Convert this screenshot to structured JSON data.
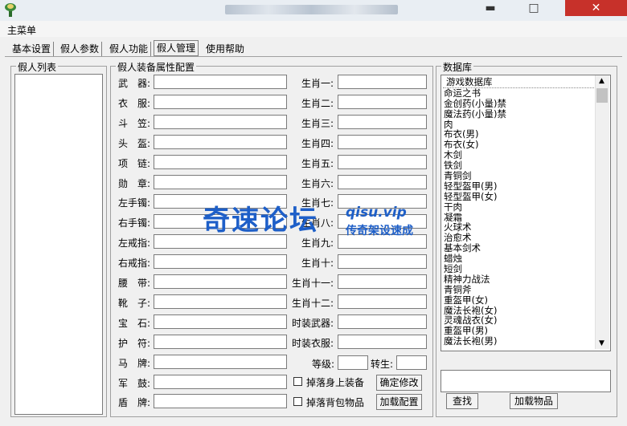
{
  "window": {
    "title": "",
    "controls": {
      "minimize": "▬",
      "maximize": "□",
      "close": "✕"
    }
  },
  "menu": {
    "main": "主菜单"
  },
  "tabs": [
    "基本设置",
    "假人参数",
    "假人功能",
    "假人管理",
    "使用帮助"
  ],
  "active_tab": "假人管理",
  "left_panel": {
    "title": "假人列表"
  },
  "equip_panel": {
    "title": "假人装备属性配置",
    "left_fields": [
      "武　器:",
      "衣　服:",
      "斗　笠:",
      "头　盔:",
      "项　链:",
      "勋　章:",
      "左手镯:",
      "右手镯:",
      "左戒指:",
      "右戒指:",
      "腰　带:",
      "靴　子:",
      "宝　石:",
      "护　符:",
      "马　牌:",
      "军　鼓:",
      "盾　牌:"
    ],
    "right_fields": [
      "生肖一:",
      "生肖二:",
      "生肖三:",
      "生肖四:",
      "生肖五:",
      "生肖六:",
      "生肖七:",
      "生肖八:",
      "生肖九:",
      "生肖十:",
      "生肖十一:",
      "生肖十二:",
      "时装武器:",
      "时装衣服:"
    ],
    "level_label": "等级:",
    "rebirth_label": "转生:",
    "checkbox_drop_body": "掉落身上装备",
    "checkbox_drop_bag": "掉落背包物品",
    "btn_confirm": "确定修改",
    "btn_load_config": "加载配置"
  },
  "database": {
    "title": "数据库",
    "header": "游戏数据库",
    "items": [
      "命运之书",
      "金创药(小量)禁",
      "魔法药(小量)禁",
      "肉",
      "布衣(男)",
      "布衣(女)",
      "木剑",
      "铁剑",
      "青铜剑",
      "轻型盔甲(男)",
      "轻型盔甲(女)",
      "干肉",
      "凝霜",
      "火球术",
      "治愈术",
      "基本剑术",
      "蜡烛",
      "短剑",
      "精神力战法",
      "青铜斧",
      "重盔甲(女)",
      "魔法长袍(女)",
      "灵魂战衣(女)",
      "重盔甲(男)",
      "魔法长袍(男)"
    ],
    "btn_search": "查找",
    "btn_load_items": "加载物品"
  },
  "watermark": {
    "main": "奇速论坛",
    "url": "qisu.vip",
    "slogan": "传奇架设速成"
  }
}
